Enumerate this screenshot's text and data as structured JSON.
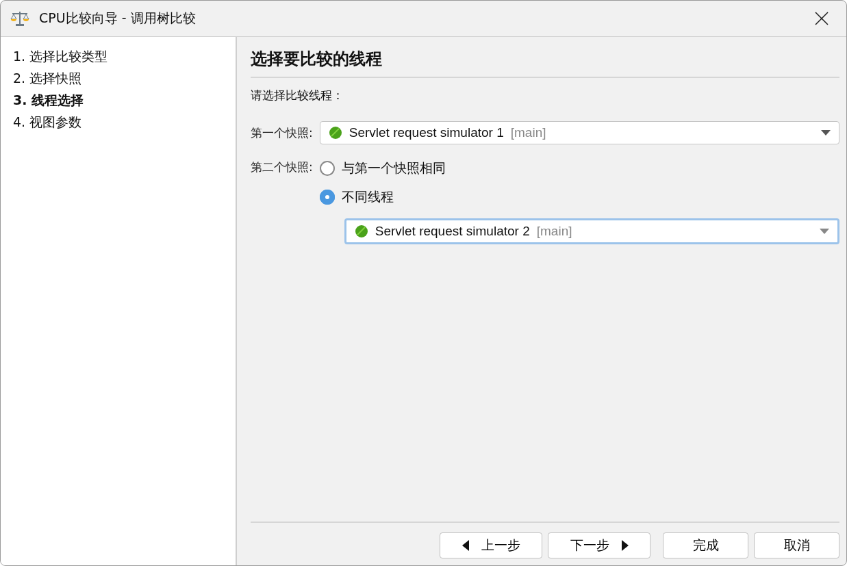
{
  "window": {
    "title": "CPU比较向导 - 调用树比较"
  },
  "steps": [
    {
      "label": "1. 选择比较类型",
      "selected": false
    },
    {
      "label": "2. 选择快照",
      "selected": false
    },
    {
      "label": "3. 线程选择",
      "selected": true
    },
    {
      "label": "4. 视图参数",
      "selected": false
    }
  ],
  "heading": "选择要比较的线程",
  "prompt": "请选择比较线程：",
  "first_snapshot": {
    "label": "第一个快照:",
    "dropdown": {
      "value": "Servlet request simulator 1",
      "tag": "[main]",
      "focused": false
    }
  },
  "second_snapshot": {
    "label": "第二个快照:",
    "options": [
      {
        "label": "与第一个快照相同",
        "selected": false
      },
      {
        "label": "不同线程",
        "selected": true
      }
    ],
    "dropdown": {
      "value": "Servlet request simulator 2",
      "tag": "[main]",
      "focused": true
    }
  },
  "buttons": [
    {
      "label": "上一步",
      "kind": "back"
    },
    {
      "label": "下一步",
      "kind": "next"
    },
    {
      "label": "完成",
      "kind": "plain"
    },
    {
      "label": "取消",
      "kind": "plain"
    }
  ]
}
